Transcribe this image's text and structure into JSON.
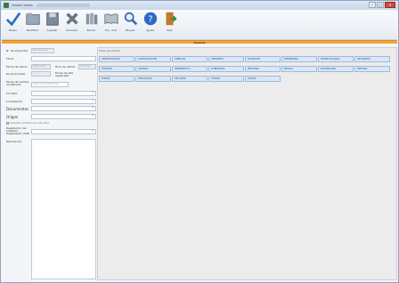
{
  "window": {
    "title": "Gestión Videos",
    "buttons": {
      "minimize": "–",
      "maximize": "□",
      "close": "✕"
    }
  },
  "toolbar": {
    "buttons": [
      {
        "label": "Nuevo",
        "icon": "check-icon"
      },
      {
        "label": "Modificar",
        "icon": "folder-icon"
      },
      {
        "label": "Guardar",
        "icon": "save-icon"
      },
      {
        "label": "Cancelar",
        "icon": "cancel-icon"
      },
      {
        "label": "Borrar",
        "icon": "books-icon"
      },
      {
        "label": "Tra...mar",
        "icon": "open-book-icon"
      },
      {
        "label": "Buscar",
        "icon": "search-icon"
      },
      {
        "label": "Ayuda",
        "icon": "help-icon"
      },
      {
        "label": "Salir",
        "icon": "exit-door-icon"
      }
    ]
  },
  "header": {
    "label": "General"
  },
  "form": {
    "fields": [
      {
        "key": "num_video",
        "label": "N° de vídeo/dvd",
        "value": "Cámara este"
      },
      {
        "key": "titulo",
        "label": "Título",
        "value": ""
      },
      {
        "key": "fecha",
        "label": "Fecha de ultimo",
        "value": "05/02/2013",
        "label2": "Hora de ultimo",
        "value2": "12:00:00"
      },
      {
        "key": "duracion",
        "label": "Duración total",
        "label2": "Fecha de alta registrada",
        "value": ""
      },
      {
        "key": "autor",
        "label": "Fecha de cambio modificado",
        "value": "Fecha de modificación"
      },
      {
        "key": "formato",
        "label": "Formato",
        "value": ""
      },
      {
        "key": "localizacion",
        "label": "Localización",
        "value": ""
      },
      {
        "key": "documentos",
        "label": "Documentos",
        "value": ""
      },
      {
        "key": "origen",
        "label": "Origen",
        "value": ""
      },
      {
        "key": "realizacion",
        "label": "Realización del subtítulo Digitalizado (S/N)",
        "value": ""
      },
      {
        "key": "descripcion",
        "label": "Descripción",
        "value": ""
      }
    ],
    "checkbox_label": "Visualizar subtítulos en este vídeo"
  },
  "tags": {
    "title": "Tipos de vídeos",
    "rows": [
      [
        "ANTROPOLOGÍA",
        "AUDIOVISUALES",
        "CIENCIAS",
        "DEPORTES",
        "ECONOMÍA",
        "ENSEÑANZA",
        "ESPIRITUALIDAD",
        "GEOGRAFÍA"
      ],
      [
        "HISTORIA",
        "IDIOMAS",
        "INFORMÁTICA",
        "LITERATURA",
        "MEDICINA",
        "MÚSICA",
        "NATURALEZA",
        "PINTURA"
      ],
      [
        "POESÍA",
        "PSICOLOGÍA",
        "RELIGIÓN",
        "TEATRO",
        "VARIOS"
      ]
    ]
  },
  "colors": {
    "accent": "#f2a53a",
    "tag_bg": "#d9e7f6"
  }
}
